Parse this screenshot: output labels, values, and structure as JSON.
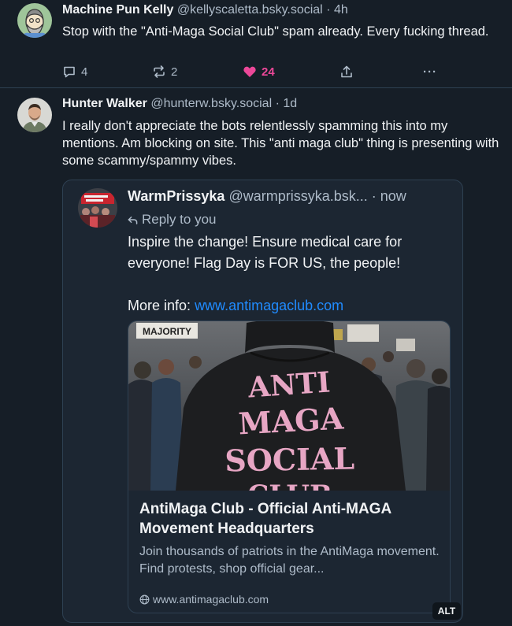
{
  "posts": [
    {
      "display_name": "Machine Pun Kelly",
      "handle": "@kellyscaletta.bsky.social",
      "separator": "·",
      "time": "4h",
      "text": "Stop with the \"Anti-Maga Social Club\" spam already. Every fucking thread.",
      "actions": {
        "replies": "4",
        "reposts": "2",
        "likes": "24",
        "more": "···"
      },
      "liked": true,
      "like_color": "#ec4899"
    },
    {
      "display_name": "Hunter Walker",
      "handle": "@hunterw.bsky.social",
      "separator": "·",
      "time": "1d",
      "text": "I really don't appreciate the bots relentlessly spamming this into my mentions. Am blocking on site. This \"anti maga club\" thing is presenting with some scammy/spammy vibes.",
      "quote": {
        "display_name": "WarmPrissyka",
        "handle": "@warmprissyka.bsk...",
        "separator": "·",
        "time": "now",
        "reply_label": "Reply to you",
        "text_line1": "Inspire the change! Ensure medical care for everyone! Flag Day is FOR US, the people!",
        "more_info_label": "More info:",
        "link_text": "www.antimagaclub.com",
        "link_color": "#208bfe",
        "external_card": {
          "image_text": [
            "ANTI",
            "MAGA",
            "SOCIAL",
            "CLUB"
          ],
          "sign_text": "MAJORITY",
          "title": "AntiMaga Club - Official Anti-MAGA Movement Headquarters",
          "description": "Join thousands of patriots in the AntiMaga movement. Find protests, shop official gear...",
          "domain": "www.antimagaclub.com",
          "alt_badge": "ALT"
        }
      }
    }
  ],
  "colors": {
    "background": "#161e27",
    "card_background": "#1c2632",
    "border": "#2e4052",
    "secondary_text": "#aebbc9",
    "primary_text": "#f1f3f5",
    "hoodie_text": "#e7a6c4"
  }
}
